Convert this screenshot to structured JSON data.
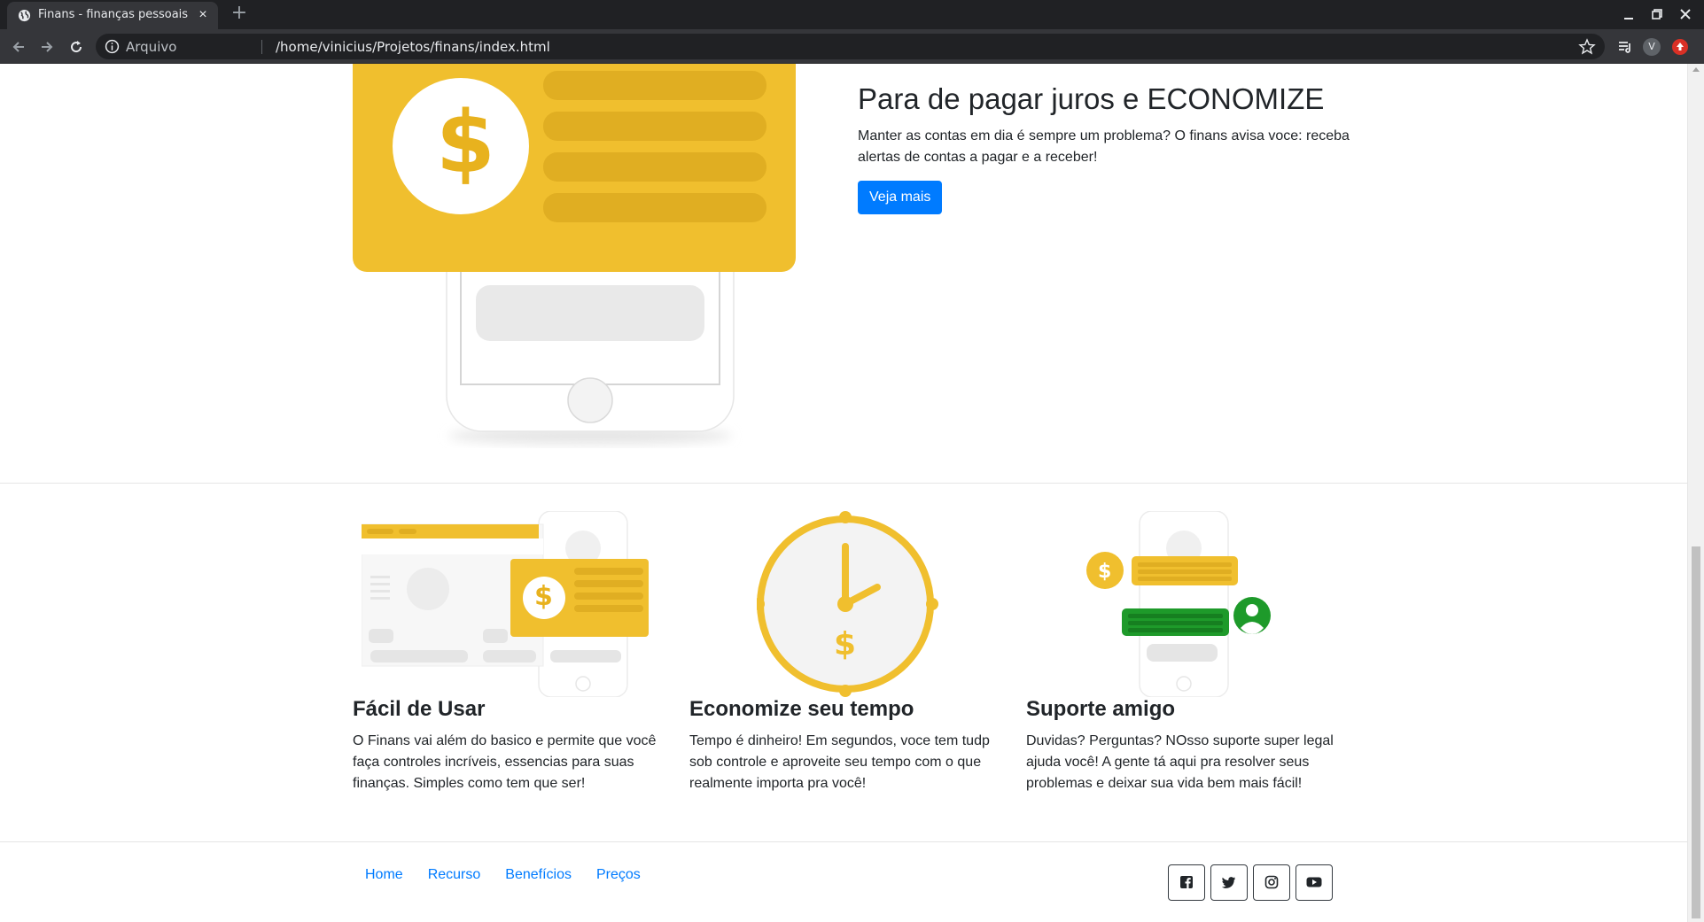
{
  "browser": {
    "tab_title": "Finans - finanças pessoais",
    "tab_close": "×",
    "new_tab": "+",
    "omnibox_chip": "Arquivo",
    "url": "/home/vinicius/Projetos/finans/index.html",
    "profile_initial": "V"
  },
  "hero": {
    "title": "Para de pagar juros e ECONOMIZE",
    "description": "Manter as contas em dia é sempre um problema? O finans avisa voce: receba alertas de contas a pagar e a receber!",
    "button_label": "Veja mais",
    "dollar_symbol": "$"
  },
  "features": [
    {
      "title": "Fácil de Usar",
      "description": "O Finans vai além do basico e permite que você faça controles incríveis, essencias para suas finanças. Simples como tem que ser!",
      "dollar_symbol": "$"
    },
    {
      "title": "Economize seu tempo",
      "description": "Tempo é dinheiro! Em segundos, voce tem tudp sob controle e aproveite seu tempo com o que realmente importa pra você!",
      "dollar_symbol": "$"
    },
    {
      "title": "Suporte amigo",
      "description": "Duvidas? Perguntas? NOsso suporte super legal ajuda você! A gente tá aqui pra resolver seus problemas e deixar sua vida bem mais fácil!",
      "dollar_symbol": "$"
    }
  ],
  "footer": {
    "links": [
      "Home",
      "Recurso",
      "Benefícios",
      "Preços"
    ],
    "social_icons": [
      "facebook-icon",
      "twitter-icon",
      "instagram-icon",
      "youtube-icon"
    ]
  },
  "colors": {
    "brand_yellow": "#f0bf2e",
    "primary_blue": "#007bff",
    "support_green": "#1e9a2a",
    "chrome_dark": "#202124"
  }
}
